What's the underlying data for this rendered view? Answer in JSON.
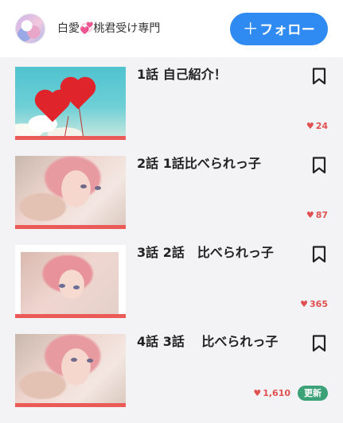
{
  "header": {
    "author_name": "白愛💞桃君受け専門",
    "follow_plus": "＋",
    "follow_label": "フォロー"
  },
  "colors": {
    "accent": "#2f8af1",
    "like": "#e05050",
    "thumb_bar": "#ea5a57",
    "badge": "#3aa276"
  },
  "episodes": [
    {
      "title": "1話 自己紹介！",
      "likes": "24",
      "badge": ""
    },
    {
      "title": "2話 1話比べられっ子",
      "likes": "87",
      "badge": ""
    },
    {
      "title": "3話 2話　比べられっ子",
      "likes": "365",
      "badge": ""
    },
    {
      "title": "4話 3話　 比べられっ子",
      "likes": "1,610",
      "badge": "更新"
    }
  ],
  "icons": {
    "bookmark": "bookmark-icon",
    "like": "heart-icon",
    "avatar": "avatar"
  },
  "like_glyph": "♥"
}
